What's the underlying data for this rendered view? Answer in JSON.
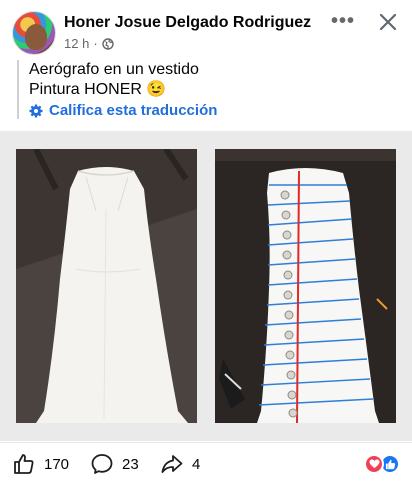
{
  "post": {
    "author": "Honer Josue Delgado Rodriguez",
    "time": "12 h",
    "separator": "·",
    "visibility_icon": "globe-icon",
    "caption_line1": "Aerógrafo en un vestido",
    "caption_line2": "Pintura HONER",
    "emoji": "😉",
    "translate_label": "Califica esta traducción"
  },
  "header_icons": {
    "more": "more-icon",
    "close": "close-icon"
  },
  "photos": [
    {
      "description_icon": "white-dress-photo"
    },
    {
      "description_icon": "notebook-dress-photo"
    }
  ],
  "engagement": {
    "likes": "170",
    "comments": "23",
    "shares": "4",
    "reactions": [
      "love",
      "like"
    ]
  },
  "colors": {
    "link": "#216fdb",
    "secondary": "#65676b",
    "love": "#f33e58",
    "like": "#1877f2"
  }
}
